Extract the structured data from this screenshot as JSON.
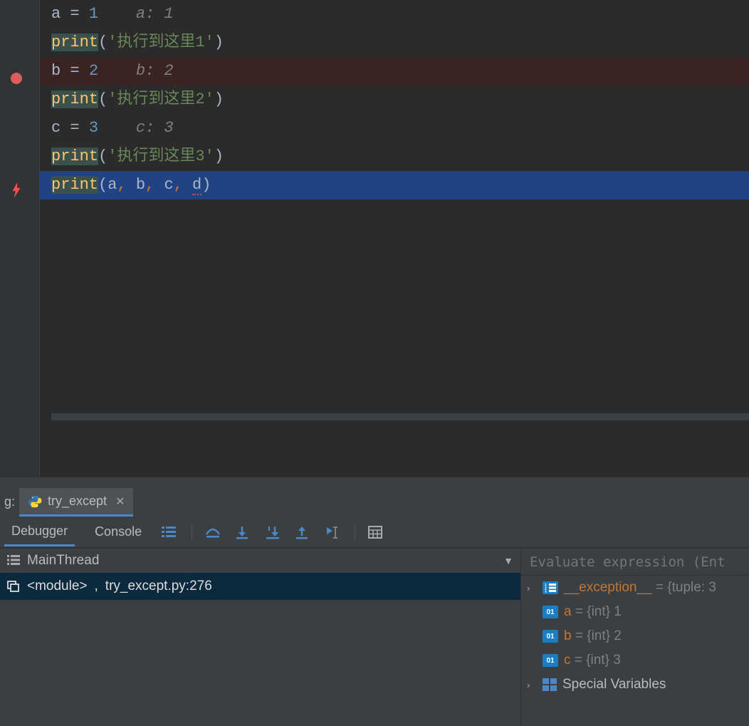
{
  "code": {
    "lines": [
      {
        "kind": "assign",
        "var": "a",
        "val": "1",
        "hint_var": "a",
        "hint_val": "1",
        "gutter": null
      },
      {
        "kind": "print_str",
        "str": "'执行到这里1'",
        "gutter": null
      },
      {
        "kind": "assign",
        "var": "b",
        "val": "2",
        "hint_var": "b",
        "hint_val": "2",
        "gutter": "breakpoint",
        "bg": "bp"
      },
      {
        "kind": "print_str",
        "str": "'执行到这里2'",
        "gutter": null
      },
      {
        "kind": "assign",
        "var": "c",
        "val": "3",
        "hint_var": "c",
        "hint_val": "3",
        "gutter": null
      },
      {
        "kind": "print_str",
        "str": "'执行到这里3'",
        "gutter": null
      },
      {
        "kind": "print_args",
        "args": [
          "a",
          "b",
          "c",
          "d"
        ],
        "err_arg": "d",
        "gutter": "exception",
        "bg": "exec"
      }
    ]
  },
  "debug": {
    "tab_bar_prefix": "g:",
    "run_tab": "try_except",
    "tabs": {
      "debugger": "Debugger",
      "console": "Console"
    },
    "thread": "MainThread",
    "frame": {
      "module": "<module>",
      "loc": "try_except.py:276"
    },
    "eval_placeholder": "Evaluate expression (Ent",
    "vars": [
      {
        "expand": true,
        "icon": "list",
        "name": "__exception__",
        "rest": " = {tuple: 3"
      },
      {
        "expand": false,
        "icon": "01",
        "name": "a",
        "rest": " = {int} 1"
      },
      {
        "expand": false,
        "icon": "01",
        "name": "b",
        "rest": " = {int} 2"
      },
      {
        "expand": false,
        "icon": "01",
        "name": "c",
        "rest": " = {int} 3"
      },
      {
        "expand": true,
        "icon": "special",
        "name": "Special Variables",
        "rest": ""
      }
    ]
  }
}
